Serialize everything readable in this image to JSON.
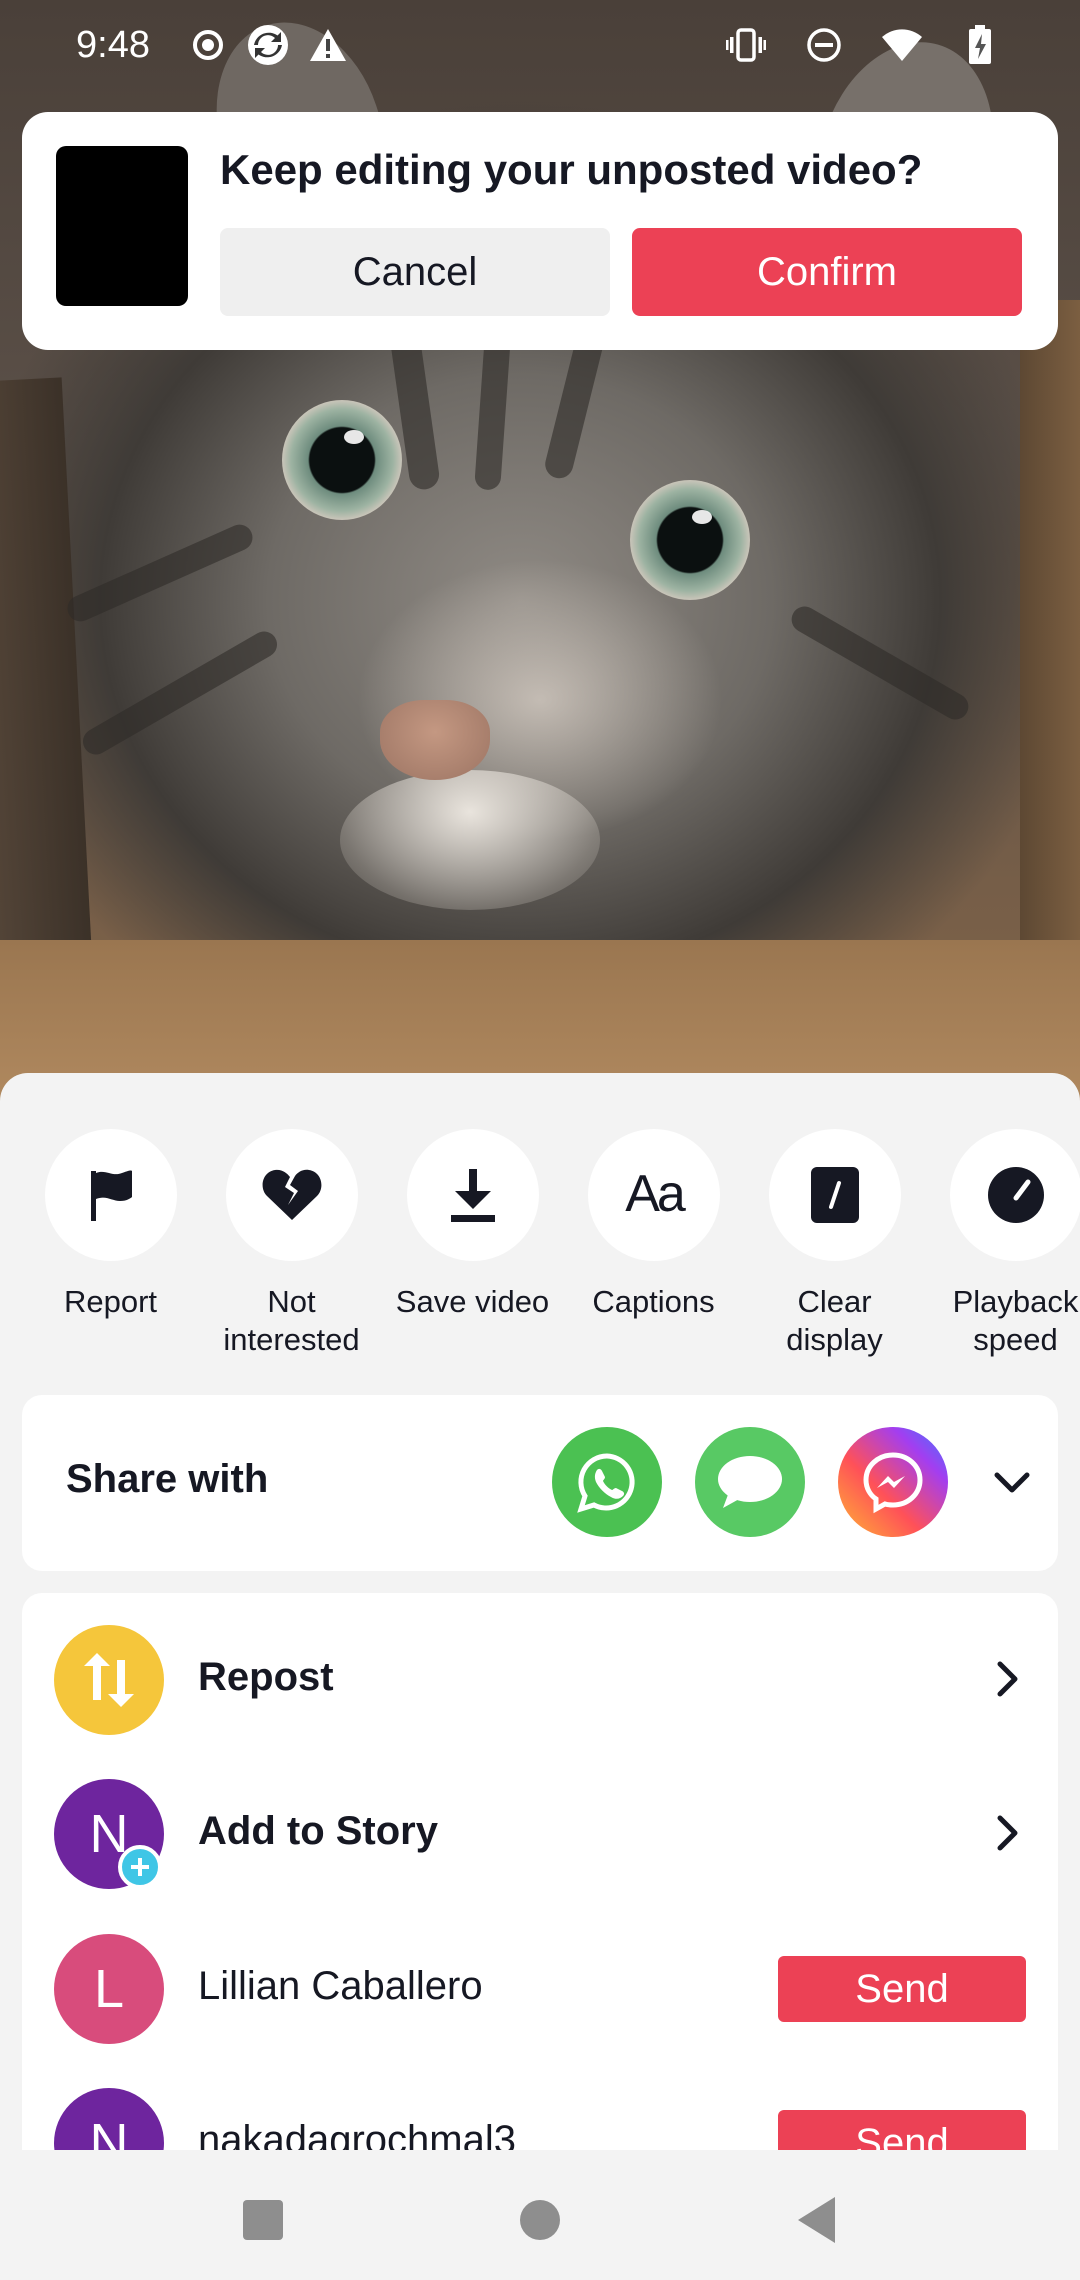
{
  "status_bar": {
    "time": "9:48",
    "left_icons": [
      "record-icon",
      "sync-icon",
      "warning-icon"
    ],
    "right_icons": [
      "vibrate-icon",
      "dnd-icon",
      "wifi-icon",
      "battery-charging-icon"
    ]
  },
  "dialog": {
    "title": "Keep editing your unposted video?",
    "cancel_label": "Cancel",
    "confirm_label": "Confirm",
    "confirm_color": "#ec4155"
  },
  "actions": [
    {
      "label": "Report",
      "icon": "flag-icon"
    },
    {
      "label": "Not\ninterested",
      "icon": "broken-heart-icon"
    },
    {
      "label": "Save video",
      "icon": "download-icon"
    },
    {
      "label": "Captions",
      "icon": "captions-icon"
    },
    {
      "label": "Clear\ndisplay",
      "icon": "clear-display-icon"
    },
    {
      "label": "Playback\nspeed",
      "icon": "speed-icon"
    }
  ],
  "share": {
    "title": "Share with",
    "apps": [
      {
        "name": "WhatsApp",
        "icon": "whatsapp-icon"
      },
      {
        "name": "Messages",
        "icon": "sms-icon"
      },
      {
        "name": "Messenger",
        "icon": "messenger-icon"
      }
    ]
  },
  "list": {
    "repost": {
      "label": "Repost",
      "color": "#f5c63b"
    },
    "story": {
      "label": "Add to Story",
      "initial": "N",
      "color": "#6e259e"
    },
    "contacts": [
      {
        "name": "Lillian Caballero",
        "initial": "L",
        "color": "#d84c7c",
        "send_label": "Send"
      },
      {
        "name": "nakadagrochmal3",
        "initial": "N",
        "color": "#6e259e",
        "send_label": "Send"
      }
    ]
  },
  "accent_color": "#ec4155"
}
